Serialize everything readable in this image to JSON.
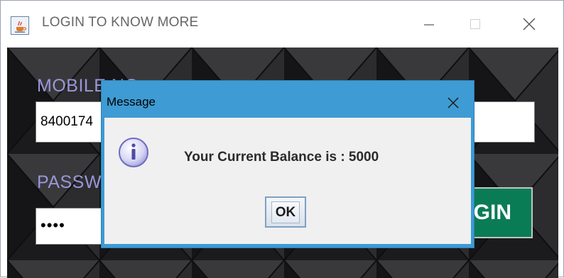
{
  "window": {
    "title": "LOGIN TO KNOW MORE"
  },
  "form": {
    "mobile_label": "MOBILE NO",
    "mobile_value": "8400174",
    "password_label": "PASSWORD",
    "password_value": "••••",
    "login_label": "LOGIN"
  },
  "dialog": {
    "title": "Message",
    "message": "Your Current Balance is : 5000",
    "ok_label": "OK",
    "icon": "info-icon"
  },
  "colors": {
    "label": "#9a96d8",
    "login_button": "#0a7c55",
    "dialog_frame": "#3e9bd3",
    "dialog_body": "#f0f0f0",
    "background": "#1d1d1f"
  }
}
